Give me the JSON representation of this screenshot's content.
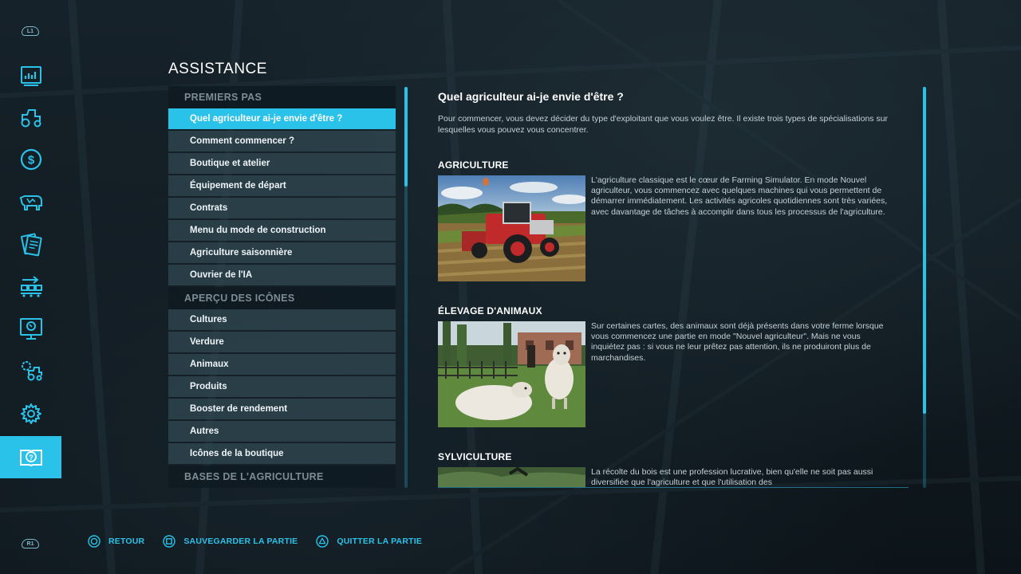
{
  "sidebar": {
    "top_shoulder": "L1",
    "bottom_shoulder": "R1",
    "items": [
      {
        "icon": "stats-chart-icon"
      },
      {
        "icon": "tractor-icon"
      },
      {
        "icon": "dollar-icon"
      },
      {
        "icon": "cow-icon"
      },
      {
        "icon": "contracts-icon"
      },
      {
        "icon": "production-chain-icon"
      },
      {
        "icon": "map-pin-board-icon"
      },
      {
        "icon": "garage-settings-icon"
      },
      {
        "icon": "gear-icon"
      },
      {
        "icon": "help-book-icon",
        "active": true
      }
    ]
  },
  "page_title": "ASSISTANCE",
  "list": {
    "categories": [
      {
        "label": "PREMIERS PAS",
        "items": [
          "Quel agriculteur ai-je envie d'être ?",
          "Comment commencer ?",
          "Boutique et atelier",
          "Équipement de départ",
          "Contrats",
          "Menu du mode de construction",
          "Agriculture saisonnière",
          "Ouvrier de l'IA"
        ]
      },
      {
        "label": "APERÇU DES ICÔNES",
        "items": [
          "Cultures",
          "Verdure",
          "Animaux",
          "Produits",
          "Booster de rendement",
          "Autres",
          "Icônes de la boutique"
        ]
      },
      {
        "label": "BASES DE L'AGRICULTURE",
        "items": []
      }
    ],
    "selected": "Quel agriculteur ai-je envie d'être ?"
  },
  "content": {
    "title": "Quel agriculteur ai-je envie d'être ?",
    "intro": "Pour commencer, vous devez décider du type d'exploitant que vous voulez être. Il existe trois types de spécialisations sur lesquelles vous pouvez vous concentrer.",
    "sections": [
      {
        "title": "AGRICULTURE",
        "text": "L'agriculture classique est le cœur de Farming Simulator. En mode Nouvel agriculteur, vous commencez avec quelques machines qui vous permettent de démarrer immédiatement. Les activités agricoles quotidiennes sont très variées, avec davantage de tâches à accomplir dans tous les processus de l'agriculture."
      },
      {
        "title": "ÉLEVAGE D'ANIMAUX",
        "text": "Sur certaines cartes, des animaux sont déjà présents dans votre ferme lorsque vous commencez une partie en mode \"Nouvel agriculteur\". Mais ne vous inquiétez pas : si vous ne leur prêtez pas attention, ils ne produiront plus de marchandises."
      },
      {
        "title": "SYLVICULTURE",
        "text": "La récolte du bois est une profession lucrative, bien qu'elle ne soit pas aussi diversifiée que l'agriculture et que l'utilisation des"
      }
    ]
  },
  "footer": {
    "back": "RETOUR",
    "save": "SAUVEGARDER LA PARTIE",
    "quit": "QUITTER LA PARTIE"
  },
  "colors": {
    "accent": "#2bc2ea",
    "list_item_bg": "#304650",
    "category_text": "#7d8c94"
  }
}
